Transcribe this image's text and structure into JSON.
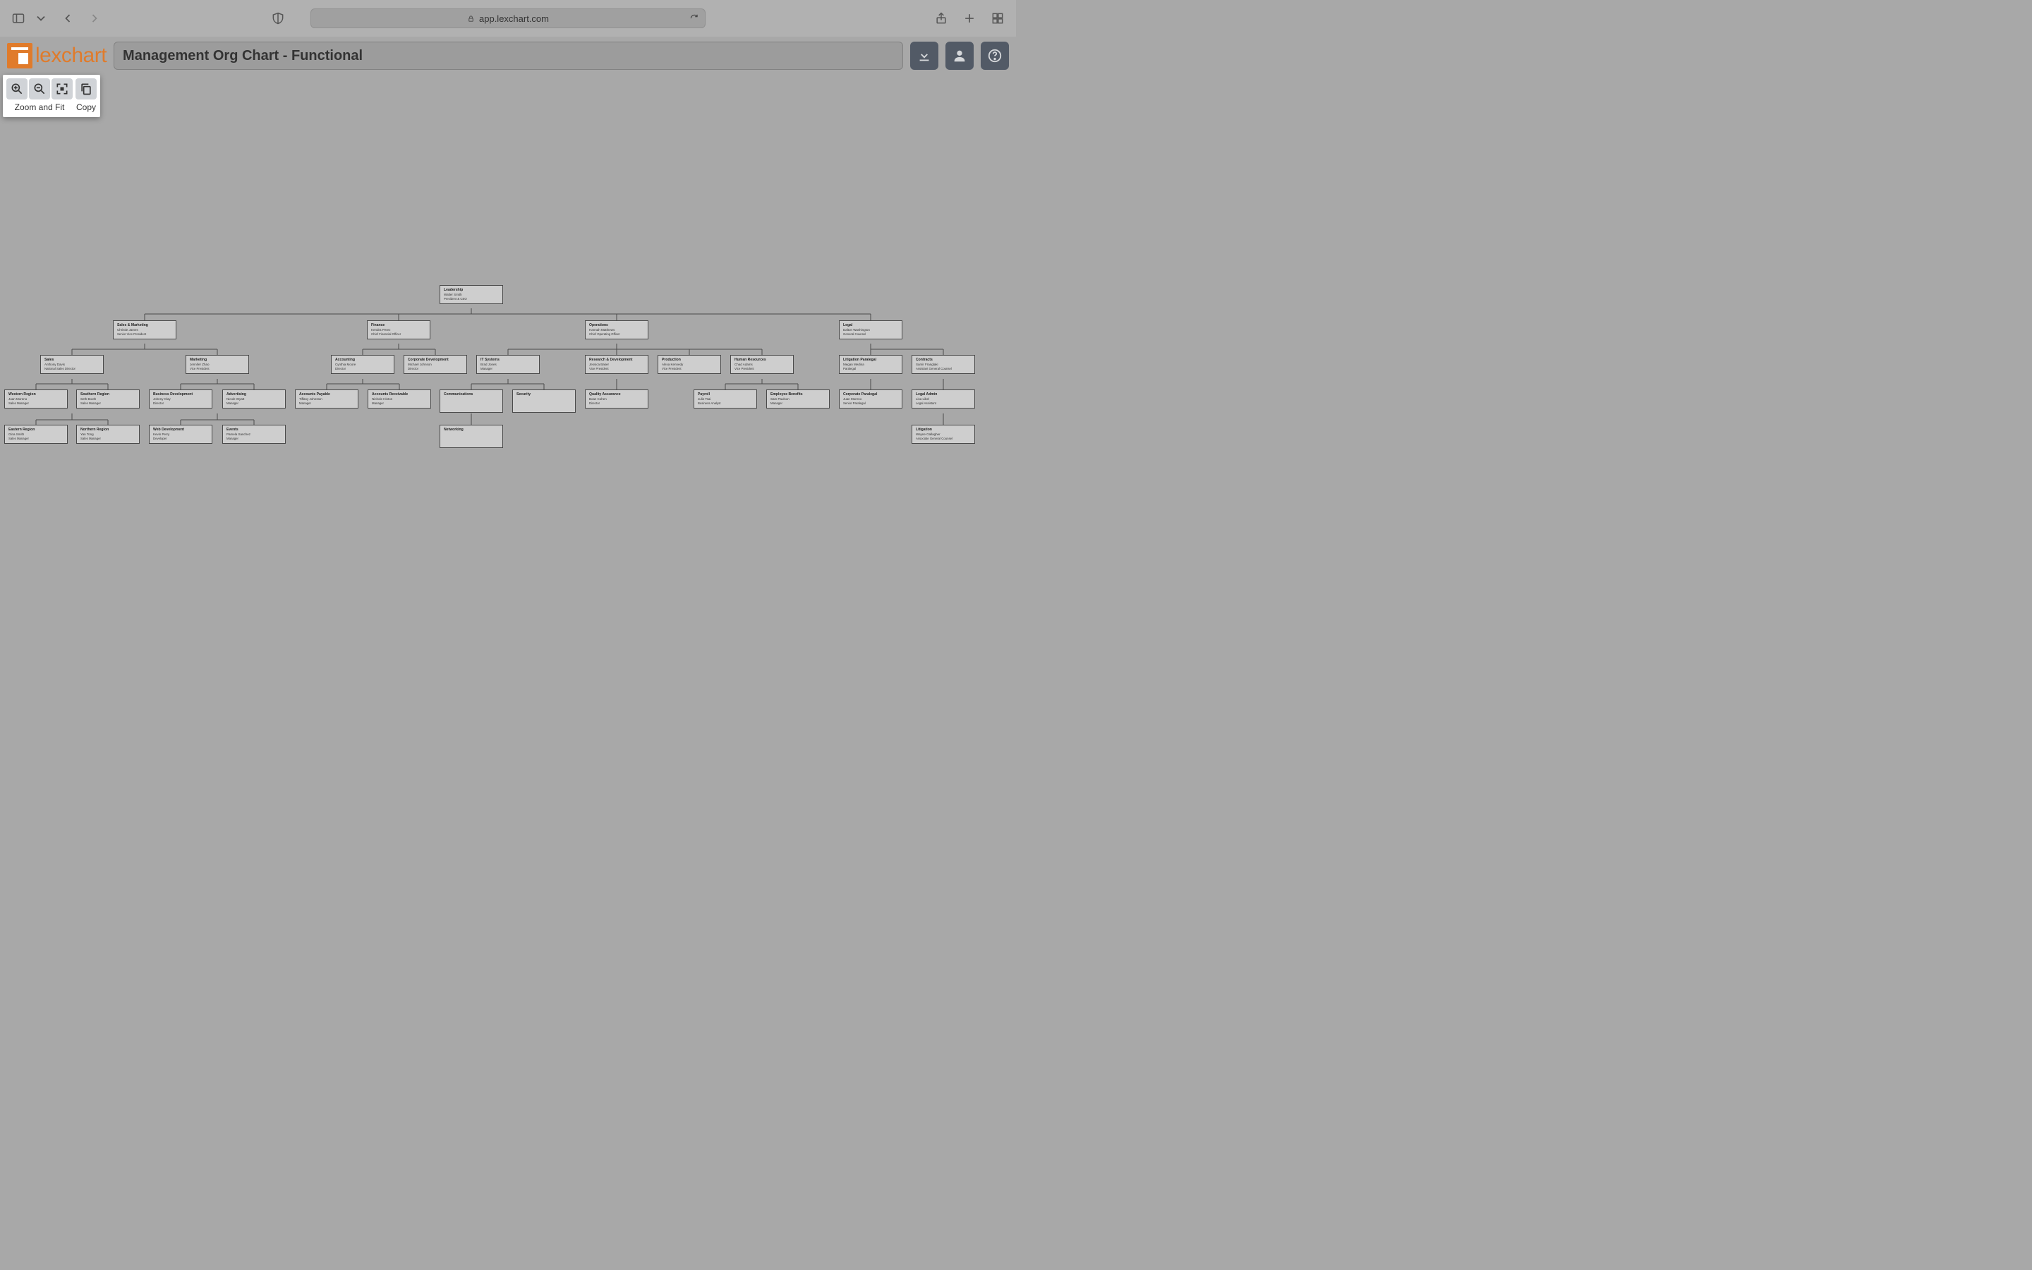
{
  "browser": {
    "url": "app.lexchart.com"
  },
  "header": {
    "logo_text": "lexchart",
    "title": "Management Org Chart - Functional"
  },
  "toolbar": {
    "zoom_label": "Zoom and Fit",
    "copy_label": "Copy"
  },
  "nodes": {
    "leadership": {
      "dept": "Leadership",
      "name": "Walter Smith",
      "title": "President & CEO"
    },
    "salesmkt": {
      "dept": "Sales & Marketing",
      "name": "Christie James",
      "title": "Senior Vice President"
    },
    "finance": {
      "dept": "Finance",
      "name": "Kendra Perez",
      "title": "Chief Financial Officer"
    },
    "operations": {
      "dept": "Operations",
      "name": "Hannah Matthews",
      "title": "Chief Operating Officer"
    },
    "legal": {
      "dept": "Legal",
      "name": "Dalton Washington",
      "title": "General Counsel"
    },
    "sales": {
      "dept": "Sales",
      "name": "Anthony Davis",
      "title": "National Sales Director"
    },
    "marketing": {
      "dept": "Marketing",
      "name": "Jennifer Zhao",
      "title": "Vice President"
    },
    "accounting": {
      "dept": "Accounting",
      "name": "Cynthia Moore",
      "title": "Director"
    },
    "corpdev": {
      "dept": "Corporate Development",
      "name": "Michael Johnson",
      "title": "Director"
    },
    "itsystems": {
      "dept": "IT Systems",
      "name": "Brad Jones",
      "title": "Manager"
    },
    "rnd": {
      "dept": "Research & Development",
      "name": "Jessica Baker",
      "title": "Vice President"
    },
    "production": {
      "dept": "Production",
      "name": "Alexa Kennedy",
      "title": "Vice President"
    },
    "hr": {
      "dept": "Human Resources",
      "name": "Chad Adams",
      "title": "Vice President"
    },
    "litpara": {
      "dept": "Litigation Paralegal",
      "name": "Megan Medina",
      "title": "Paralegal"
    },
    "contracts": {
      "dept": "Contracts",
      "name": "Samir Franglaki",
      "title": "Assistant General Counsel"
    },
    "western": {
      "dept": "Western Region",
      "name": "Juan Moreno",
      "title": "Sales Manager"
    },
    "southern": {
      "dept": "Southern Region",
      "name": "Seth Booth",
      "title": "Sales Manager"
    },
    "bizdev": {
      "dept": "Business Development",
      "name": "Johnny Clay",
      "title": "Director"
    },
    "advertising": {
      "dept": "Advertising",
      "name": "Nicole Wyatt",
      "title": "Manager"
    },
    "ap": {
      "dept": "Accounts Payable",
      "name": "Tiffany Johnston",
      "title": "Manager"
    },
    "ar": {
      "dept": "Accounts Receivable",
      "name": "Nichole Hinton",
      "title": "Manager"
    },
    "comms": {
      "dept": "Communications",
      "name": "",
      "title": ""
    },
    "security": {
      "dept": "Security",
      "name": "",
      "title": ""
    },
    "qa": {
      "dept": "Quality Assurance",
      "name": "Boaz Cohen",
      "title": "Director"
    },
    "payroll": {
      "dept": "Payroll",
      "name": "Julie Tsai",
      "title": "Business Analyst"
    },
    "benefits": {
      "dept": "Employee Benefits",
      "name": "Sam Paulson",
      "title": "Manager"
    },
    "corppara": {
      "dept": "Corporate Paralegal",
      "name": "Juan Moreno",
      "title": "Senior Paralegal"
    },
    "legaladmin": {
      "dept": "Legal Admin",
      "name": "Lisa Libel",
      "title": "Legal Assistant"
    },
    "eastern": {
      "dept": "Eastern Region",
      "name": "Gina Smith",
      "title": "Sales Manager"
    },
    "northern": {
      "dept": "Northern Region",
      "name": "Yan Tong",
      "title": "Sales Manager"
    },
    "webdev": {
      "dept": "Web Development",
      "name": "Kevin Perry",
      "title": "Developer"
    },
    "events": {
      "dept": "Events",
      "name": "Pamela Sanchez",
      "title": "Manager"
    },
    "networking": {
      "dept": "Networking",
      "name": "",
      "title": ""
    },
    "litigation": {
      "dept": "Litigation",
      "name": "Wayne Gallagher",
      "title": "Associate General Counsel"
    }
  },
  "chart_data": {
    "type": "tree",
    "title": "Management Org Chart - Functional",
    "root": {
      "dept": "Leadership",
      "name": "Walter Smith",
      "title": "President & CEO",
      "children": [
        {
          "dept": "Sales & Marketing",
          "name": "Christie James",
          "title": "Senior Vice President",
          "children": [
            {
              "dept": "Sales",
              "name": "Anthony Davis",
              "title": "National Sales Director",
              "children": [
                {
                  "dept": "Western Region",
                  "name": "Juan Moreno",
                  "title": "Sales Manager"
                },
                {
                  "dept": "Southern Region",
                  "name": "Seth Booth",
                  "title": "Sales Manager"
                },
                {
                  "dept": "Eastern Region",
                  "name": "Gina Smith",
                  "title": "Sales Manager"
                },
                {
                  "dept": "Northern Region",
                  "name": "Yan Tong",
                  "title": "Sales Manager"
                }
              ]
            },
            {
              "dept": "Marketing",
              "name": "Jennifer Zhao",
              "title": "Vice President",
              "children": [
                {
                  "dept": "Business Development",
                  "name": "Johnny Clay",
                  "title": "Director"
                },
                {
                  "dept": "Advertising",
                  "name": "Nicole Wyatt",
                  "title": "Manager"
                },
                {
                  "dept": "Web Development",
                  "name": "Kevin Perry",
                  "title": "Developer"
                },
                {
                  "dept": "Events",
                  "name": "Pamela Sanchez",
                  "title": "Manager"
                }
              ]
            }
          ]
        },
        {
          "dept": "Finance",
          "name": "Kendra Perez",
          "title": "Chief Financial Officer",
          "children": [
            {
              "dept": "Accounting",
              "name": "Cynthia Moore",
              "title": "Director",
              "children": [
                {
                  "dept": "Accounts Payable",
                  "name": "Tiffany Johnston",
                  "title": "Manager"
                },
                {
                  "dept": "Accounts Receivable",
                  "name": "Nichole Hinton",
                  "title": "Manager"
                }
              ]
            },
            {
              "dept": "Corporate Development",
              "name": "Michael Johnson",
              "title": "Director"
            }
          ]
        },
        {
          "dept": "Operations",
          "name": "Hannah Matthews",
          "title": "Chief Operating Officer",
          "children": [
            {
              "dept": "IT Systems",
              "name": "Brad Jones",
              "title": "Manager",
              "children": [
                {
                  "dept": "Communications"
                },
                {
                  "dept": "Security"
                },
                {
                  "dept": "Networking"
                }
              ]
            },
            {
              "dept": "Research & Development",
              "name": "Jessica Baker",
              "title": "Vice President",
              "children": [
                {
                  "dept": "Quality Assurance",
                  "name": "Boaz Cohen",
                  "title": "Director"
                }
              ]
            },
            {
              "dept": "Production",
              "name": "Alexa Kennedy",
              "title": "Vice President"
            },
            {
              "dept": "Human Resources",
              "name": "Chad Adams",
              "title": "Vice President",
              "children": [
                {
                  "dept": "Payroll",
                  "name": "Julie Tsai",
                  "title": "Business Analyst"
                },
                {
                  "dept": "Employee Benefits",
                  "name": "Sam Paulson",
                  "title": "Manager"
                }
              ]
            }
          ]
        },
        {
          "dept": "Legal",
          "name": "Dalton Washington",
          "title": "General Counsel",
          "children": [
            {
              "dept": "Litigation Paralegal",
              "name": "Megan Medina",
              "title": "Paralegal",
              "children": [
                {
                  "dept": "Corporate Paralegal",
                  "name": "Juan Moreno",
                  "title": "Senior Paralegal"
                }
              ]
            },
            {
              "dept": "Contracts",
              "name": "Samir Franglaki",
              "title": "Assistant General Counsel",
              "children": [
                {
                  "dept": "Legal Admin",
                  "name": "Lisa Libel",
                  "title": "Legal Assistant"
                },
                {
                  "dept": "Litigation",
                  "name": "Wayne Gallagher",
                  "title": "Associate General Counsel"
                }
              ]
            }
          ]
        }
      ]
    }
  }
}
